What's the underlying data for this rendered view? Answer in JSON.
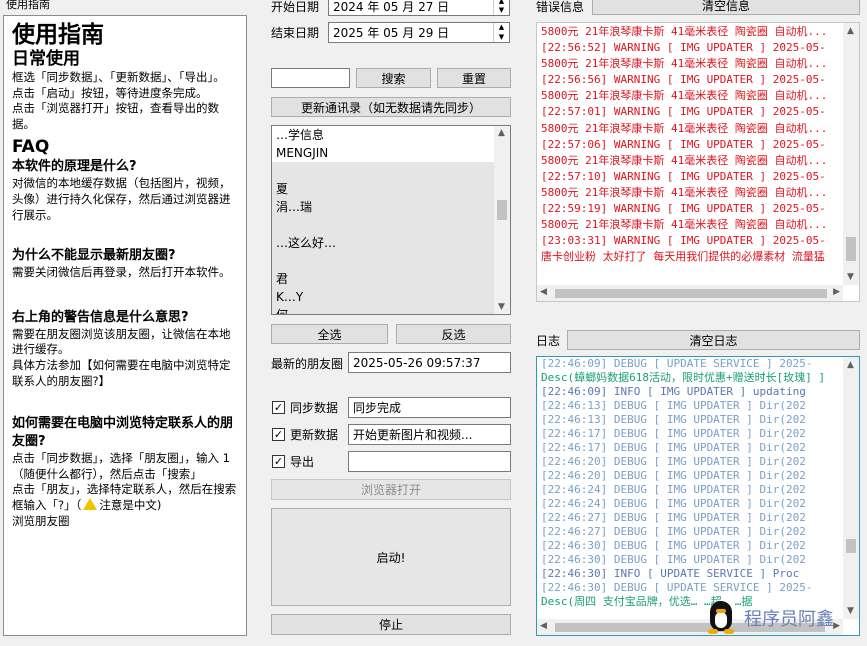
{
  "guide": {
    "panel_label": "使用指南",
    "title": "使用指南",
    "section_daily": "日常使用",
    "daily_lines": [
      "框选「同步数据」、「更新数据」、「导出」。",
      "点击「启动」按钮，等待进度条完成。",
      "点击「浏览器打开」按钮，查看导出的数据。"
    ],
    "faq_title": "FAQ",
    "faq": [
      {
        "q": "本软件的原理是什么?",
        "a": [
          "对微信的本地缓存数据（包括图片，视频，头像）进行持久化保存，然后通过浏览器进行展示。"
        ]
      },
      {
        "q": "为什么不能显示最新朋友圈?",
        "a": [
          "需要关闭微信后再登录，然后打开本软件。"
        ]
      },
      {
        "q": "右上角的警告信息是什么意思?",
        "a": [
          "需要在朋友圈浏览该朋友圈，让微信在本地进行缓存。",
          "具体方法参加【如何需要在电脑中浏览特定联系人的朋友圈?】"
        ]
      },
      {
        "q": "如何需要在电脑中浏览特定联系人的朋友圈?",
        "a": [
          "点击「同步数据」，选择「朋友圈」，输入 1 （随便什么都行），然后点击「搜索」",
          "点击「朋友」，选择特定联系人，然后在搜索框输入「?」（",
          "注意是中文)",
          "浏览朋友圈"
        ]
      }
    ]
  },
  "controls": {
    "start_date_label": "开始日期",
    "start_date": "2024 年 05 月 27 日",
    "end_date_label": "结束日期",
    "end_date": "2025 年 05 月 29 日",
    "search_value": "",
    "search_button": "搜索",
    "reset_button": "重置",
    "update_contacts_button": "更新通讯录（如无数据请先同步）",
    "contacts": [
      "…学信息",
      "MENGJIN",
      "",
      "夏",
      "涓…瑞",
      "",
      "…这么好…",
      "",
      "君",
      "K…Y",
      "何",
      "…"
    ],
    "select_all_button": "全选",
    "invert_button": "反选",
    "latest_moment_label": "最新的朋友圈",
    "latest_moment_value": "2025-05-26 09:57:37",
    "sync_label": "同步数据",
    "sync_status": "同步完成",
    "update_label": "更新数据",
    "update_status": "开始更新图片和视频...",
    "export_label": "导出",
    "export_status": "",
    "browser_button": "浏览器打开",
    "start_button": "启动!",
    "stop_button": "停止"
  },
  "errors": {
    "label": "错误信息",
    "clear_button": "清空信息",
    "lines": [
      "5800元 21年浪琴康卡斯 41毫米表径 陶瓷圈 自动机...",
      "[22:56:52] WARNING   [ IMG UPDATER ] 2025-05-",
      "5800元 21年浪琴康卡斯 41毫米表径 陶瓷圈 自动机...",
      "[22:56:56] WARNING   [ IMG UPDATER ] 2025-05-",
      "5800元 21年浪琴康卡斯 41毫米表径 陶瓷圈 自动机...",
      "[22:57:01] WARNING   [ IMG UPDATER ] 2025-05-",
      "5800元 21年浪琴康卡斯 41毫米表径 陶瓷圈 自动机...",
      "[22:57:06] WARNING   [ IMG UPDATER ] 2025-05-",
      "5800元 21年浪琴康卡斯 41毫米表径 陶瓷圈 自动机...",
      "[22:57:10] WARNING   [ IMG UPDATER ] 2025-05-",
      "5800元 21年浪琴康卡斯 41毫米表径 陶瓷圈 自动机...",
      "[22:59:19] WARNING   [ IMG UPDATER ] 2025-05-",
      "5800元 21年浪琴康卡斯 41毫米表径 陶瓷圈 自动机...",
      "[23:03:31] WARNING   [ IMG UPDATER ] 2025-05-",
      "唐卡创业粉 太好打了 每天用我们提供的必爆素材 流量猛"
    ]
  },
  "log": {
    "label": "日志",
    "clear_button": "清空日志",
    "lines": [
      {
        "t": "[22:46:09] DEBUG     [ UPDATE SERVICE ] 2025-",
        "kind": "debug"
      },
      {
        "t": "Desc(蟑螂妈数据618活动，限时优惠+赠送时长[玫瑰] ]",
        "kind": "desc"
      },
      {
        "t": "[22:46:09] INFO      [ IMG UPDATER ] updating",
        "kind": "info"
      },
      {
        "t": "[22:46:13] DEBUG     [ IMG UPDATER ] Dir(202",
        "kind": "debug"
      },
      {
        "t": "[22:46:13] DEBUG     [ IMG UPDATER ] Dir(202",
        "kind": "debug"
      },
      {
        "t": "[22:46:17] DEBUG     [ IMG UPDATER ] Dir(202",
        "kind": "debug"
      },
      {
        "t": "[22:46:17] DEBUG     [ IMG UPDATER ] Dir(202",
        "kind": "debug"
      },
      {
        "t": "[22:46:20] DEBUG     [ IMG UPDATER ] Dir(202",
        "kind": "debug"
      },
      {
        "t": "[22:46:20] DEBUG     [ IMG UPDATER ] Dir(202",
        "kind": "debug"
      },
      {
        "t": "[22:46:24] DEBUG     [ IMG UPDATER ] Dir(202",
        "kind": "debug"
      },
      {
        "t": "[22:46:24] DEBUG     [ IMG UPDATER ] Dir(202",
        "kind": "debug"
      },
      {
        "t": "[22:46:27] DEBUG     [ IMG UPDATER ] Dir(202",
        "kind": "debug"
      },
      {
        "t": "[22:46:27] DEBUG     [ IMG UPDATER ] Dir(202",
        "kind": "debug"
      },
      {
        "t": "[22:46:30] DEBUG     [ IMG UPDATER ] Dir(202",
        "kind": "debug"
      },
      {
        "t": "[22:46:30] DEBUG     [ IMG UPDATER ] Dir(202",
        "kind": "debug"
      },
      {
        "t": "[22:46:30] INFO      [ UPDATE SERVICE ] Proc",
        "kind": "info"
      },
      {
        "t": "[22:46:30] DEBUG     [ UPDATE SERVICE ] 2025-",
        "kind": "debug"
      },
      {
        "t": "Desc(周四  支付宝品牌，优选…  …超…  …据",
        "kind": "desc"
      }
    ]
  },
  "watermark": "程序员阿鑫",
  "colors": {
    "error_text": "#e0141e",
    "debug_text": "#78a0c8",
    "info_text": "#5a78b4",
    "desc_text": "#1aa06e",
    "log_border": "#2f9bb5"
  }
}
